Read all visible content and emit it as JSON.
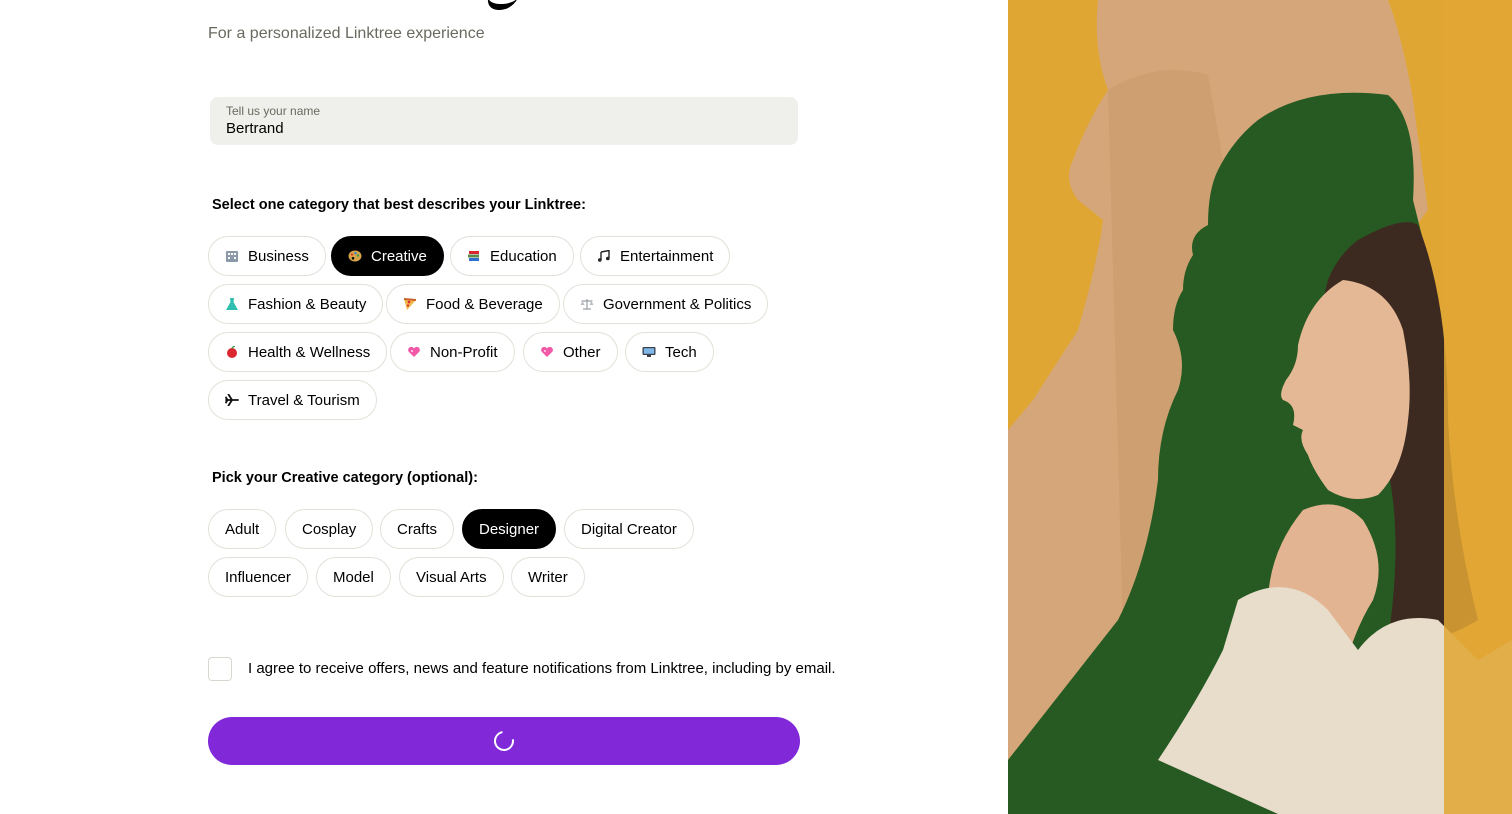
{
  "header": {
    "subtitle": "For a personalized Linktree experience"
  },
  "name_field": {
    "label": "Tell us your name",
    "value": "Bertrand"
  },
  "category_section": {
    "title": "Select one category that best describes your Linktree:",
    "selected": "Creative",
    "options": [
      {
        "label": "Business",
        "icon": "office-building-icon",
        "icon_color": "#8a98a8"
      },
      {
        "label": "Creative",
        "icon": "artist-palette-icon",
        "icon_color": "#d8a44a"
      },
      {
        "label": "Education",
        "icon": "books-icon",
        "icon_color": "#5a8a4a"
      },
      {
        "label": "Entertainment",
        "icon": "musical-notes-icon",
        "icon_color": "#222222"
      },
      {
        "label": "Fashion & Beauty",
        "icon": "dress-icon",
        "icon_color": "#2fbfb0"
      },
      {
        "label": "Food & Beverage",
        "icon": "pizza-icon",
        "icon_color": "#e0762e"
      },
      {
        "label": "Government & Politics",
        "icon": "balance-scale-icon",
        "icon_color": "#9aa0a6"
      },
      {
        "label": "Health & Wellness",
        "icon": "apple-icon",
        "icon_color": "#d9262f"
      },
      {
        "label": "Non-Profit",
        "icon": "sparkling-heart-icon",
        "icon_color": "#f25aa8"
      },
      {
        "label": "Other",
        "icon": "sparkling-heart-icon",
        "icon_color": "#f25aa8"
      },
      {
        "label": "Tech",
        "icon": "desktop-computer-icon",
        "icon_color": "#3a3f47"
      },
      {
        "label": "Travel & Tourism",
        "icon": "airplane-icon",
        "icon_color": "#111111"
      }
    ]
  },
  "subcategory_section": {
    "title": "Pick your Creative category (optional):",
    "selected": "Designer",
    "options": [
      "Adult",
      "Cosplay",
      "Crafts",
      "Designer",
      "Digital Creator",
      "Influencer",
      "Model",
      "Visual Arts",
      "Writer"
    ]
  },
  "consent": {
    "text": "I agree to receive offers, news and feature notifications from Linktree, including by email.",
    "checked": false
  },
  "submit_button": {
    "state": "loading",
    "color": "#8129d9",
    "icon": "loading-spinner-icon"
  },
  "hero_image": {
    "subject": "woman-in-profile-collage",
    "colors": {
      "background": "#e0a634",
      "green": "#265a22",
      "paper": "#d4a67a"
    }
  }
}
